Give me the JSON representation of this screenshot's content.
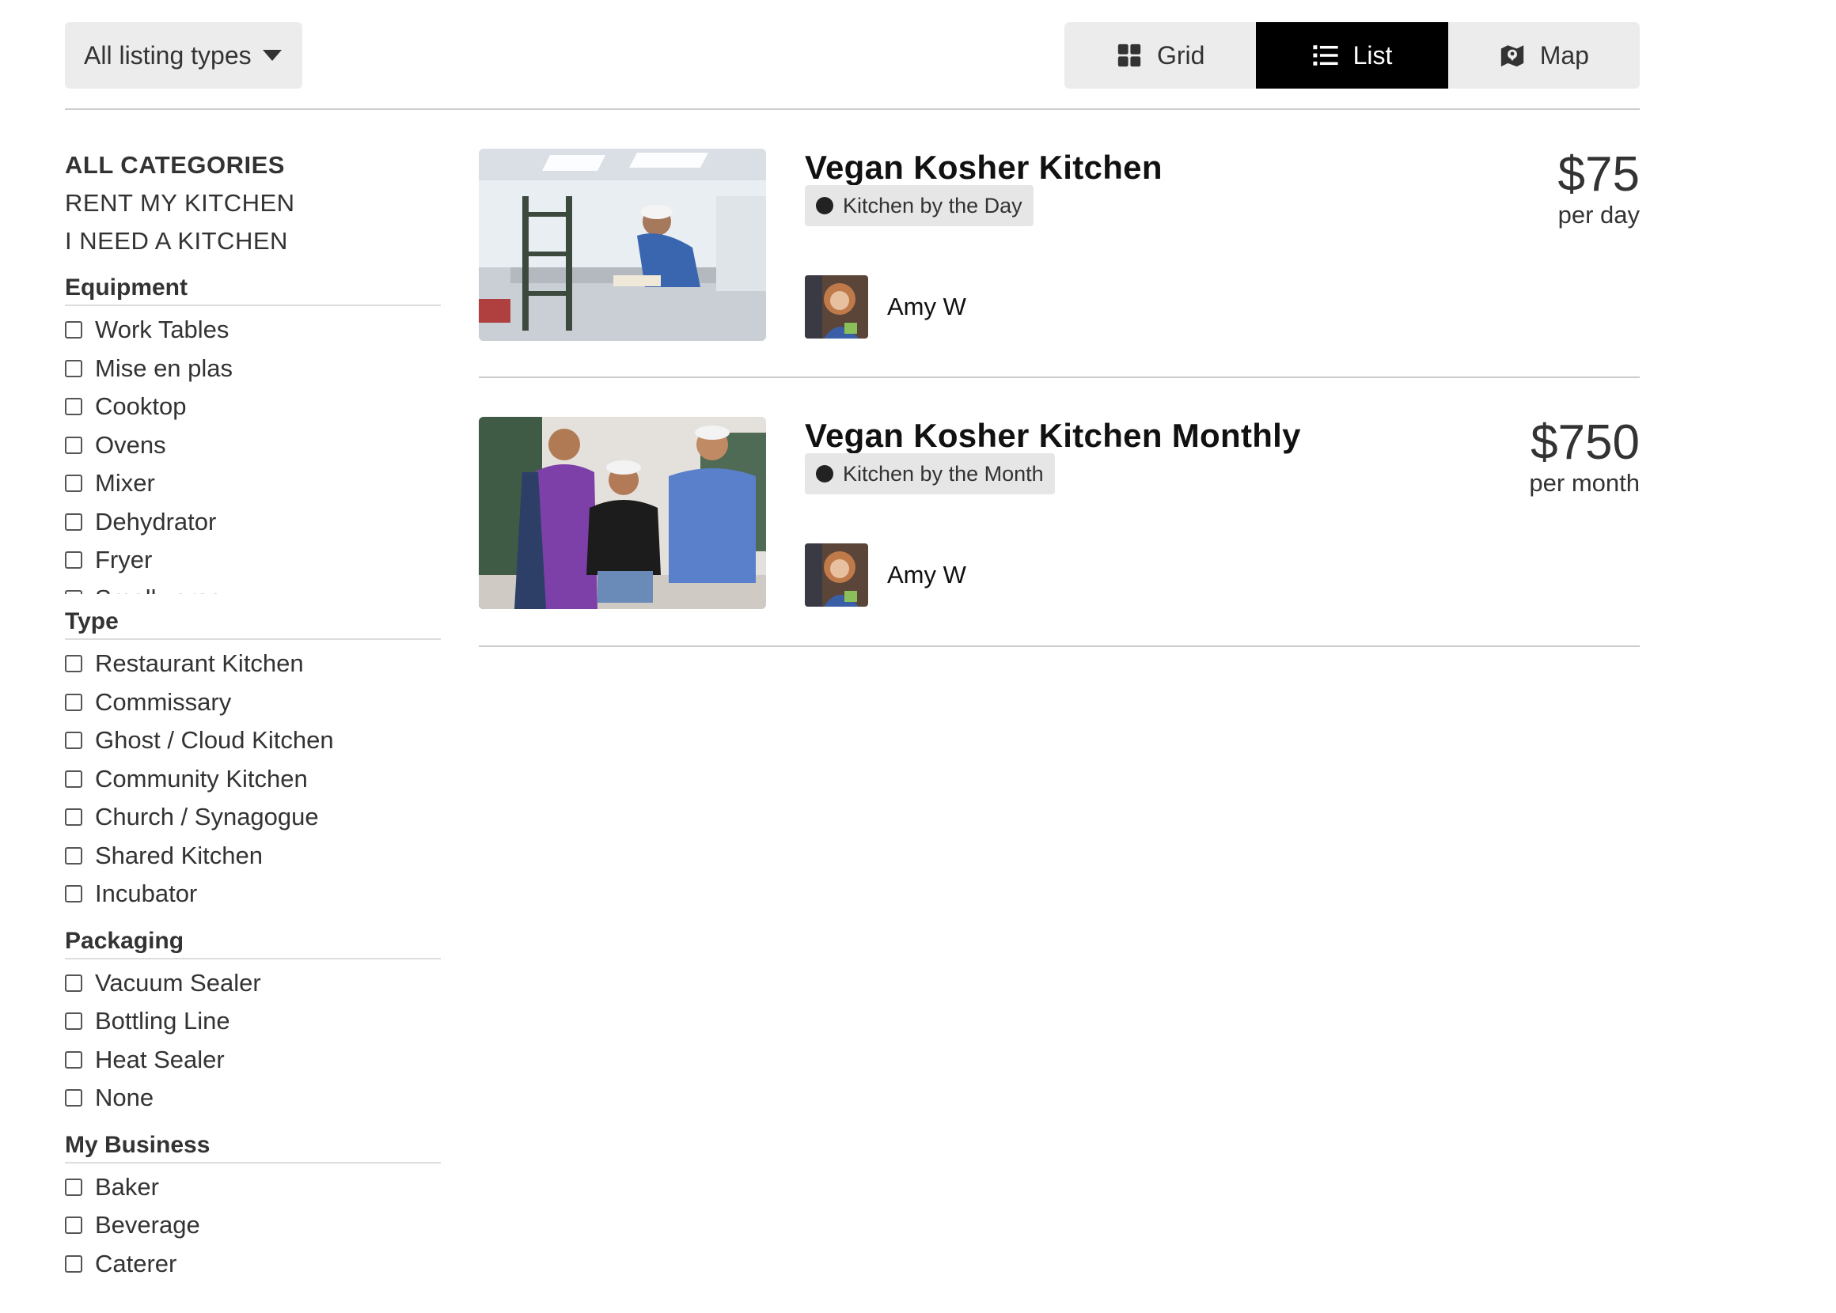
{
  "toolbar": {
    "listing_type": "All listing types",
    "views": [
      {
        "label": "Grid",
        "icon": "grid-icon",
        "active": false
      },
      {
        "label": "List",
        "icon": "list-icon",
        "active": true
      },
      {
        "label": "Map",
        "icon": "map-icon",
        "active": false
      }
    ]
  },
  "sidebar": {
    "categories": [
      "ALL CATEGORIES",
      "RENT MY KITCHEN",
      "I NEED A KITCHEN"
    ],
    "groups": [
      {
        "title": "Equipment",
        "options": [
          "Work Tables",
          "Mise en plas",
          "Cooktop",
          "Ovens",
          "Mixer",
          "Dehydrator",
          "Fryer",
          "Smallwares"
        ]
      },
      {
        "title": "Type",
        "options": [
          "Restaurant Kitchen",
          "Commissary",
          "Ghost / Cloud Kitchen",
          "Community Kitchen",
          "Church / Synagogue",
          "Shared Kitchen",
          "Incubator"
        ]
      },
      {
        "title": "Packaging",
        "options": [
          "Vacuum Sealer",
          "Bottling Line",
          "Heat Sealer",
          "None"
        ]
      },
      {
        "title": "My Business",
        "options": [
          "Baker",
          "Beverage",
          "Caterer"
        ]
      }
    ]
  },
  "listings": [
    {
      "title": "Vegan Kosher Kitchen",
      "badge": "Kitchen by the Day",
      "price": "$75",
      "price_unit": "per day",
      "host": "Amy W"
    },
    {
      "title": "Vegan Kosher Kitchen Monthly",
      "badge": "Kitchen by the Month",
      "price": "$750",
      "price_unit": "per month",
      "host": "Amy W"
    }
  ]
}
